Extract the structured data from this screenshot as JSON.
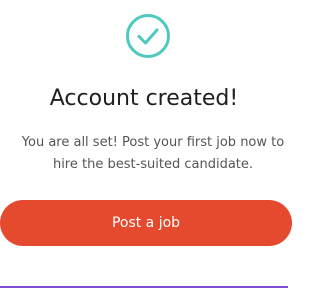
{
  "dialog": {
    "icon": "check-circle-icon",
    "icon_color": "#4fc9bd",
    "title": "Account created!",
    "message": "You are all set! Post your first job now to hire the best-suited candidate.",
    "primary_button_label": "Post a job",
    "primary_button_color": "#e5492e"
  }
}
